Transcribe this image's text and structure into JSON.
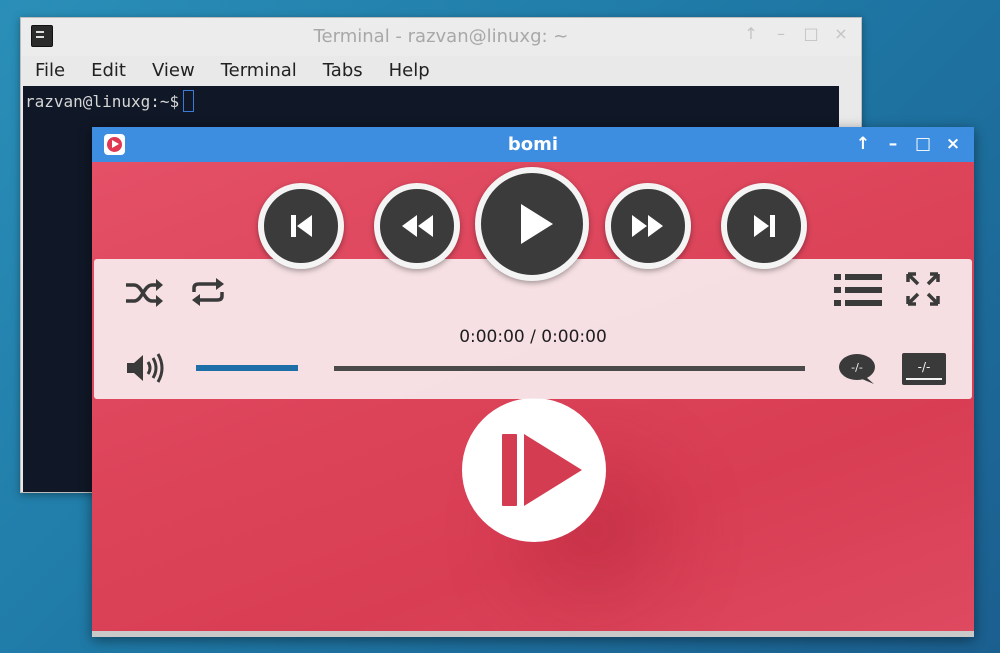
{
  "terminal": {
    "title": "Terminal - razvan@linuxg: ~",
    "menu": [
      "File",
      "Edit",
      "View",
      "Terminal",
      "Tabs",
      "Help"
    ],
    "prompt": "razvan@linuxg:~$",
    "controls": [
      "↑",
      "–",
      "□",
      "×"
    ]
  },
  "player": {
    "title": "bomi",
    "time": "0:00:00 / 0:00:00",
    "controls": [
      "↑",
      "–",
      "□",
      "×"
    ],
    "volume_fraction": 1.0,
    "seek_fraction": 0.0,
    "accent_color": "#1e6fa7",
    "bg_color": "#d9435a",
    "titlebar_color": "#3d8ee0"
  },
  "icons": {
    "shuffle": "shuffle-icon",
    "repeat": "repeat-icon",
    "previous": "skip-previous-icon",
    "rewind": "rewind-icon",
    "play": "play-icon",
    "forward": "fast-forward-icon",
    "next": "skip-next-icon",
    "playlist": "playlist-icon",
    "fullscreen": "fullscreen-icon",
    "volume": "volume-icon",
    "subtitle": "subtitle-icon",
    "audio_track": "audio-track-icon"
  }
}
